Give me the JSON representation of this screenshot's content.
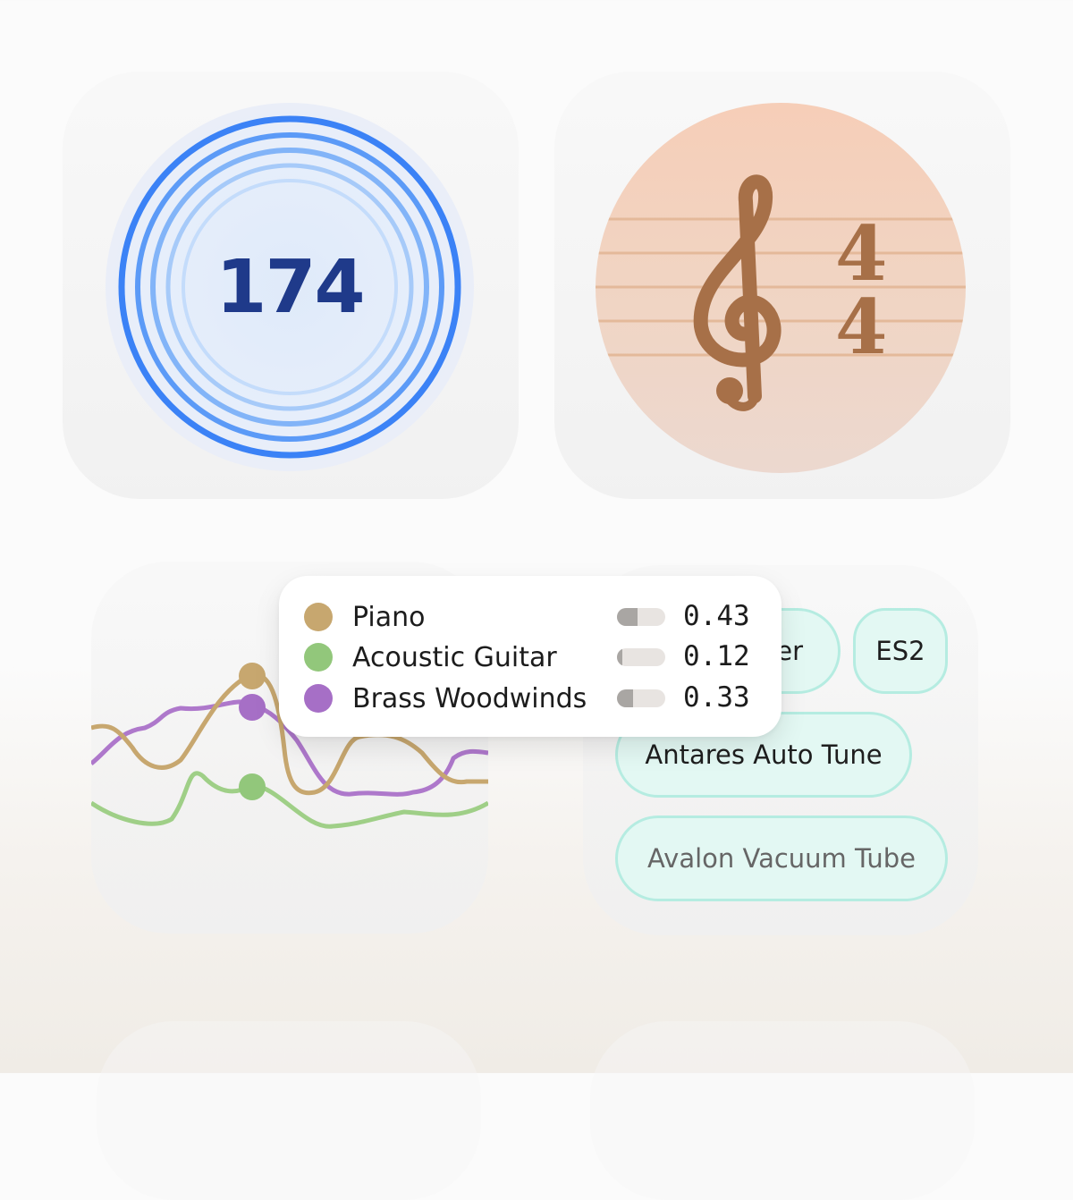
{
  "tempo": {
    "bpm": "174",
    "ring_colors": [
      "#3b82f6",
      "#5b9af7",
      "#82b4f8",
      "#a6caf9",
      "#c4dcfb"
    ]
  },
  "time_signature": {
    "top": "4",
    "bottom": "4",
    "clef_icon": "treble-clef-icon",
    "staff_color": "#e4b99a",
    "glyph_color": "#a77048"
  },
  "instruments": {
    "legend": [
      {
        "name": "Piano",
        "value": "0.43",
        "level": 0.43,
        "color": "#c7a76f"
      },
      {
        "name": "Acoustic Guitar",
        "value": "0.12",
        "level": 0.12,
        "color": "#92c77b"
      },
      {
        "name": "Brass Woodwinds",
        "value": "0.33",
        "level": 0.33,
        "color": "#a66fc6"
      }
    ]
  },
  "plugins": {
    "chips": [
      "ner",
      "ES2",
      "Antares Auto Tune",
      "Avalon Vacuum Tube"
    ],
    "accent_border": "#b5ece1",
    "accent_fill": "#e3f8f3"
  }
}
